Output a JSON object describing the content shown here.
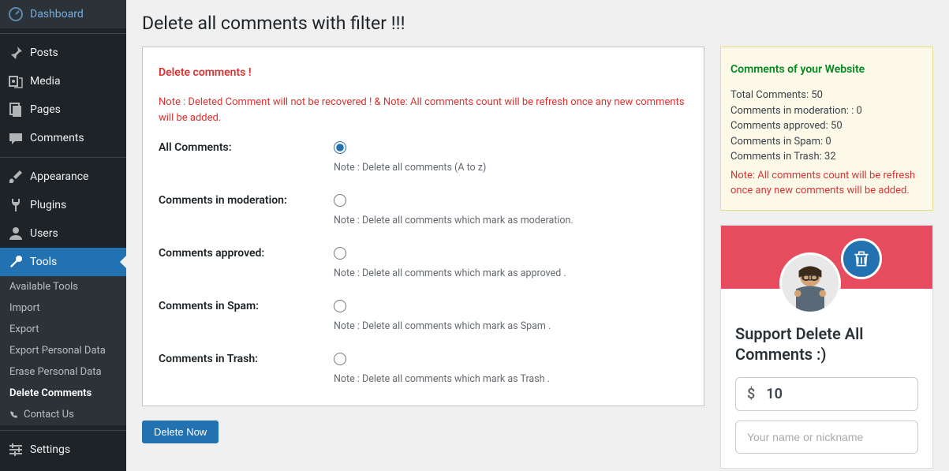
{
  "sidebar": {
    "items": [
      {
        "label": "Dashboard",
        "icon": "dashboard"
      },
      {
        "label": "Posts",
        "icon": "pin"
      },
      {
        "label": "Media",
        "icon": "media"
      },
      {
        "label": "Pages",
        "icon": "pages"
      },
      {
        "label": "Comments",
        "icon": "comments"
      },
      {
        "label": "Appearance",
        "icon": "brush"
      },
      {
        "label": "Plugins",
        "icon": "plug"
      },
      {
        "label": "Users",
        "icon": "user"
      },
      {
        "label": "Tools",
        "icon": "wrench"
      },
      {
        "label": "Settings",
        "icon": "settings"
      }
    ],
    "submenu": [
      {
        "label": "Available Tools"
      },
      {
        "label": "Import"
      },
      {
        "label": "Export"
      },
      {
        "label": "Export Personal Data"
      },
      {
        "label": "Erase Personal Data"
      },
      {
        "label": "Delete Comments"
      },
      {
        "label": "Contact Us"
      }
    ]
  },
  "page_title": "Delete all comments with filter !!!",
  "form": {
    "heading": "Delete comments !",
    "note": "Note : Deleted Comment will not be recovered ! & Note: All comments count will be refresh once any new comments will be added.",
    "rows": [
      {
        "label": "All Comments:",
        "desc": "Note : Delete all comments (A to z)"
      },
      {
        "label": "Comments in moderation:",
        "desc": "Note : Delete all comments which mark as moderation."
      },
      {
        "label": "Comments approved:",
        "desc": "Note : Delete all comments which mark as approved ."
      },
      {
        "label": "Comments in Spam:",
        "desc": "Note : Delete all comments which mark as Spam ."
      },
      {
        "label": "Comments in Trash:",
        "desc": "Note : Delete all comments which mark as Trash ."
      }
    ],
    "submit": "Delete Now"
  },
  "stats": {
    "title": "Comments of your Website",
    "total_label": "Total Comments:",
    "total_value": "50",
    "moderation_label": "Comments in moderation: :",
    "moderation_value": "0",
    "approved_label": "Comments approved:",
    "approved_value": "50",
    "spam_label": "Comments in Spam:",
    "spam_value": "0",
    "trash_label": "Comments in Trash:",
    "trash_value": "32",
    "note": "Note: All comments count will be refresh once any new comments will be added."
  },
  "donate": {
    "title": "Support Delete All Comments :)",
    "currency": "$",
    "amount": "10",
    "name_placeholder": "Your name or nickname"
  }
}
